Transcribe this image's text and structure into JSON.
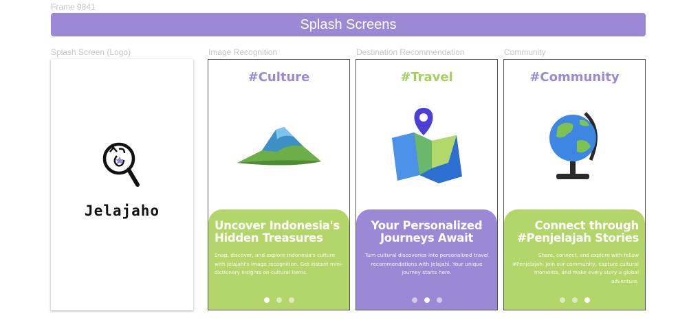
{
  "frame": {
    "label": "Frame 9841"
  },
  "header": {
    "title": "Splash Screens"
  },
  "colors": {
    "purple": "#9b89d6",
    "green": "#b3d66a"
  },
  "screens": [
    {
      "label": "Splash Screen (Logo)",
      "logo_text": "Jelajaho"
    },
    {
      "label": "Image Recognition",
      "hashtag": "#Culture",
      "title": "Uncover Indonesia's Hidden Treasures",
      "body": "Snap, discover, and explore Indonesia's culture with Jelajahi's image recognition. Get instant mini-dictionary insights on cultural items.",
      "active_dot": 1,
      "icon": "mountain-icon"
    },
    {
      "label": "Destination Recommendation",
      "hashtag": "#Travel",
      "title": "Your Personalized Journeys Await",
      "body": "Turn cultural discoveries into personalized travel recommendations with Jelajahi. Your unique journey starts here.",
      "active_dot": 2,
      "icon": "map-pin-icon"
    },
    {
      "label": "Community",
      "hashtag": "#Community",
      "title": "Connect through #Penjelajah Stories",
      "body": "Share, connect, and explore with fellow #Penjelajah. Join our community, capture cultural moments, and make every story a global adventure.",
      "active_dot": 3,
      "icon": "globe-icon"
    }
  ]
}
